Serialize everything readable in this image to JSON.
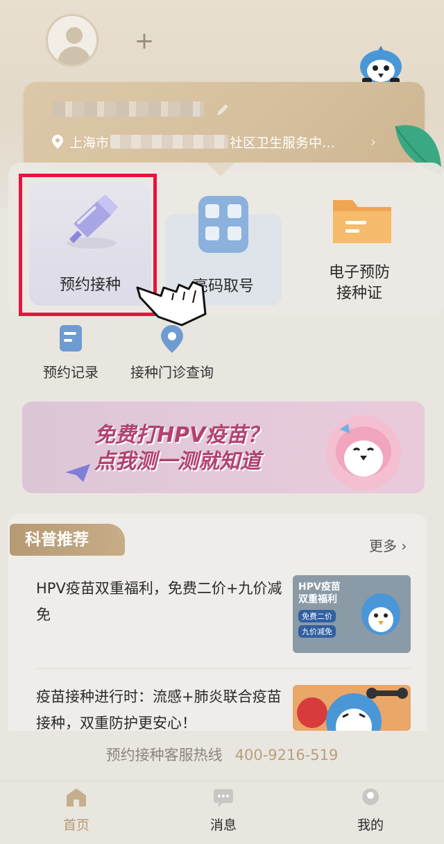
{
  "header": {
    "add_label": "+",
    "location": {
      "prefix": "上海市",
      "suffix": "社区卫生服务中…",
      "chevron": "›"
    }
  },
  "services": {
    "primary": [
      {
        "label": "预约接种",
        "icon": "syringe-icon"
      },
      {
        "label": "亮码取号",
        "icon": "qr-code-icon"
      },
      {
        "label_line1": "电子预防",
        "label_line2": "接种证",
        "icon": "folder-icon"
      }
    ],
    "secondary": [
      {
        "label": "预约记录",
        "icon": "record-icon"
      },
      {
        "label": "接种门诊查询",
        "icon": "location-pin-icon"
      }
    ]
  },
  "banner": {
    "line1": "免费打HPV疫苗？",
    "line2": "点我测一测就知道"
  },
  "news": {
    "tag": "科普推荐",
    "more": "更多 ›",
    "items": [
      {
        "title": "HPV疫苗双重福利，免费二价+九价减免",
        "thumb": {
          "line1": "HPV疫苗",
          "line2": "双重福利",
          "badge1": "免费二价",
          "badge2": "九价减免"
        }
      },
      {
        "title": "疫苗接种进行时：流感+肺炎联合疫苗接种，双重防护更安心！"
      }
    ]
  },
  "hotline": {
    "label": "预约接种客服热线",
    "number": "400-9216-519"
  },
  "tabs": [
    {
      "label": "首页",
      "icon": "home-icon",
      "active": true
    },
    {
      "label": "消息",
      "icon": "message-icon",
      "active": false
    },
    {
      "label": "我的",
      "icon": "profile-icon",
      "active": false
    }
  ],
  "colors": {
    "accent": "#b59a74",
    "highlight": "#e5143f",
    "banner_text": "#b2426f"
  }
}
